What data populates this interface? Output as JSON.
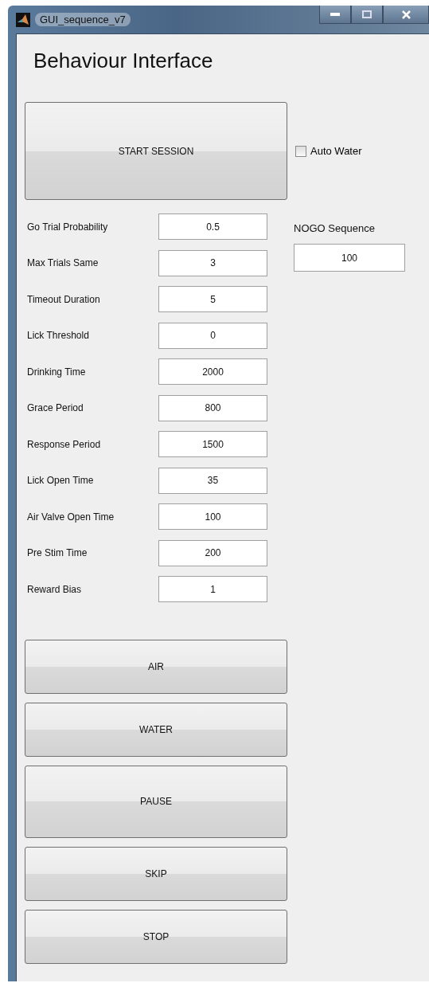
{
  "window": {
    "title": "GUI_sequence_v7"
  },
  "heading": "Behaviour Interface",
  "start_button": "START SESSION",
  "auto_water": {
    "label": "Auto Water",
    "checked": false
  },
  "parameters": [
    {
      "label": "Go Trial Probability",
      "value": "0.5"
    },
    {
      "label": "Max Trials Same",
      "value": "3"
    },
    {
      "label": "Timeout Duration",
      "value": "5"
    },
    {
      "label": "Lick Threshold",
      "value": "0"
    },
    {
      "label": "Drinking Time",
      "value": "2000"
    },
    {
      "label": "Grace Period",
      "value": "800"
    },
    {
      "label": "Response Period",
      "value": "1500"
    },
    {
      "label": "Lick Open Time",
      "value": "35"
    },
    {
      "label": "Air Valve Open Time",
      "value": "100"
    },
    {
      "label": "Pre Stim Time",
      "value": "200"
    },
    {
      "label": "Reward Bias",
      "value": "1"
    }
  ],
  "nogo_sequence": {
    "label": "NOGO Sequence",
    "value": "100"
  },
  "buttons": [
    "AIR",
    "WATER",
    "PAUSE",
    "SKIP",
    "STOP"
  ]
}
